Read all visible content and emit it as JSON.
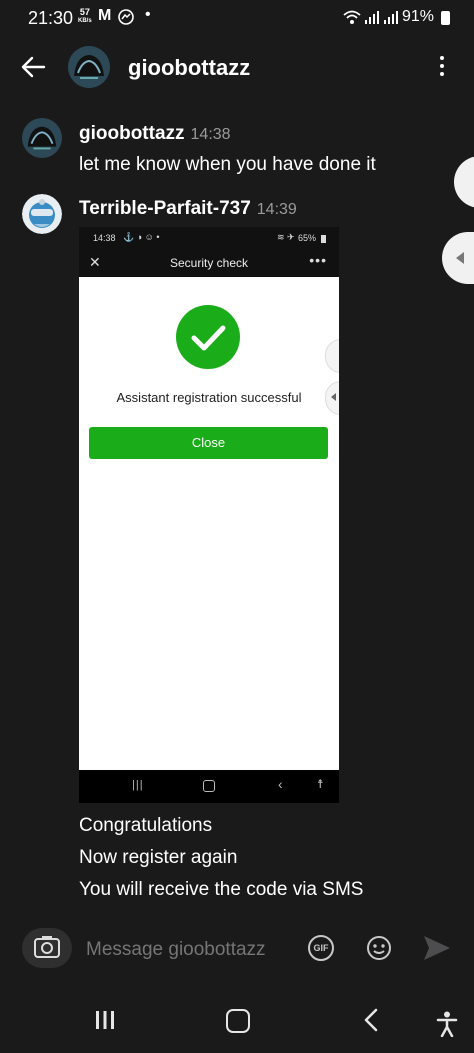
{
  "status_bar": {
    "time": "21:30",
    "speed_value": "57",
    "speed_unit": "KB/s",
    "battery": "91%",
    "icons": [
      "gmail-icon",
      "messenger-icon",
      "dot-icon",
      "wifi-icon",
      "signal-icon",
      "signal-icon",
      "battery-icon"
    ]
  },
  "header": {
    "title": "gioobottazz"
  },
  "messages": [
    {
      "user": "gioobottazz",
      "time": "14:38",
      "lines": [
        "let me know when you have done it"
      ]
    },
    {
      "user": "Terrible-Parfait-737",
      "time": "14:39",
      "lines": [
        "Congratulations",
        "Now register again",
        "You will receive the code via SMS"
      ]
    }
  ],
  "embedded_screenshot": {
    "status_time": "14:38",
    "status_battery": "65%",
    "title": "Security check",
    "message": "Assistant registration successful",
    "button": "Close",
    "accent": "#1aad19"
  },
  "composer": {
    "placeholder": "Message gioobottazz",
    "gif_label": "GIF"
  },
  "colors": {
    "background": "#1a1a1b",
    "text": "#ffffff",
    "muted": "#9a9a9a"
  }
}
